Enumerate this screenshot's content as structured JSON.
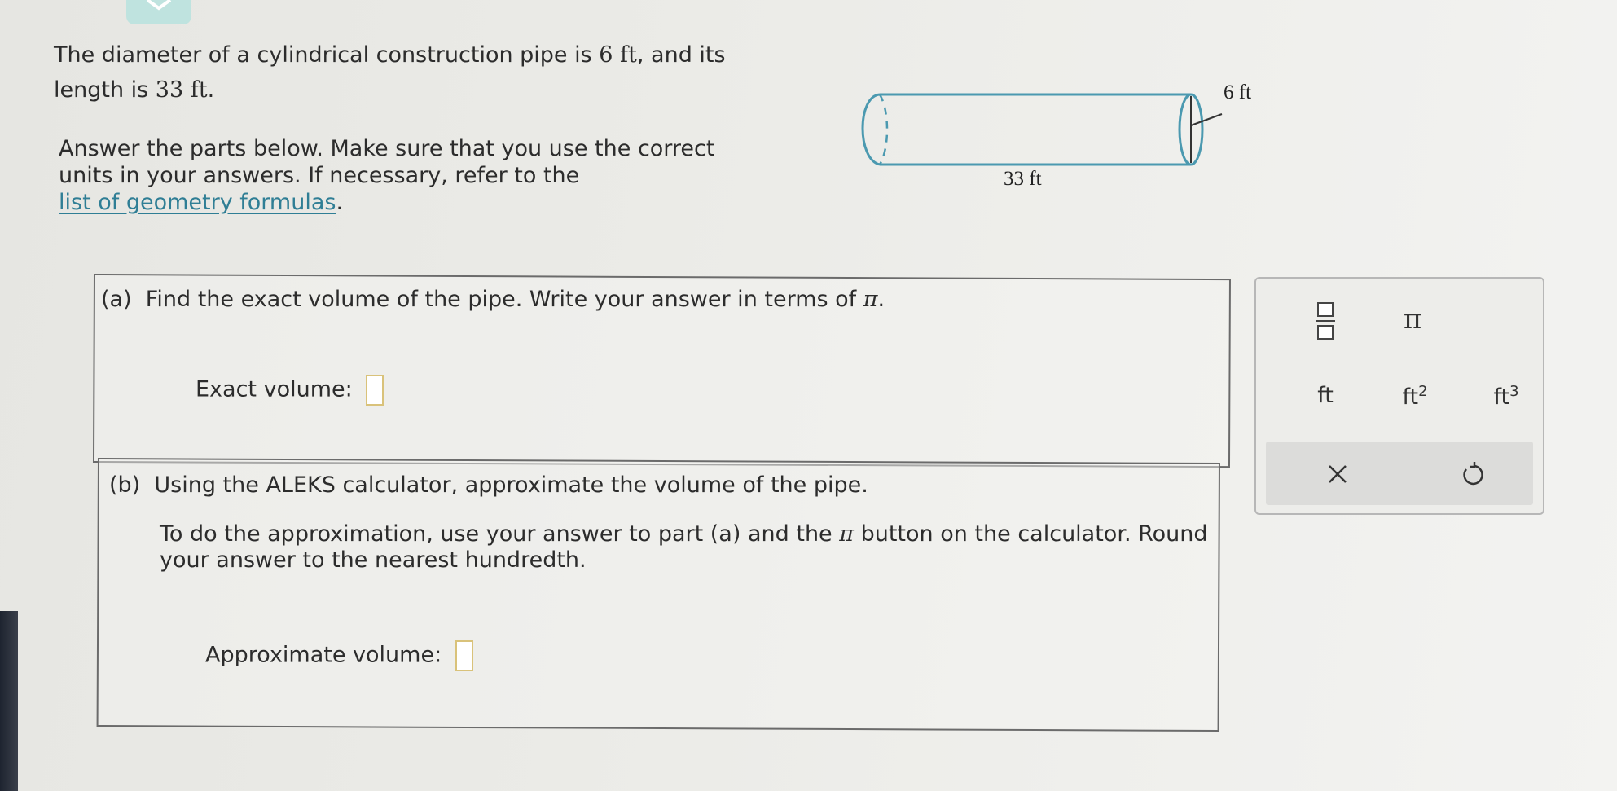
{
  "intro": {
    "line1_pre": "The diameter of a cylindrical construction pipe is ",
    "diameter": "6 ft",
    "line1_post": ", and its",
    "line2_pre": "length is ",
    "length": "33 ft",
    "line2_post": "."
  },
  "instructions": {
    "text_line1": "Answer the parts below. Make sure that you use the correct",
    "text_line2": "units in your answers. If necessary, refer to the",
    "link": "list of geometry formulas",
    "period": "."
  },
  "diagram": {
    "diameter_label": "6 ft",
    "length_label": "33 ft"
  },
  "part_a": {
    "label": "(a)",
    "question_pre": "Find the exact volume of the pipe. Write your answer in terms of ",
    "pi": "π",
    "question_post": ".",
    "answer_label": "Exact volume:"
  },
  "part_b": {
    "label": "(b)",
    "question": "Using the ALEKS calculator, approximate the volume of the pipe.",
    "detail_pre": "To do the approximation, use your answer to part (a) and the ",
    "pi": "π",
    "detail_post": " button on the calculator. Round",
    "detail_line2": "your answer to the nearest hundredth.",
    "answer_label": "Approximate volume:"
  },
  "keypad": {
    "fraction_icon": "fraction-icon",
    "pi": "π",
    "unit_ft": "ft",
    "unit_ft2": "ft",
    "unit_ft2_sup": "2",
    "unit_ft3": "ft",
    "unit_ft3_sup": "3",
    "clear_icon": "close-icon",
    "undo_icon": "undo-icon"
  },
  "colors": {
    "diagram_stroke": "#4b99b0",
    "link": "#2f7e95",
    "answer_box_border": "#d9c27a"
  }
}
